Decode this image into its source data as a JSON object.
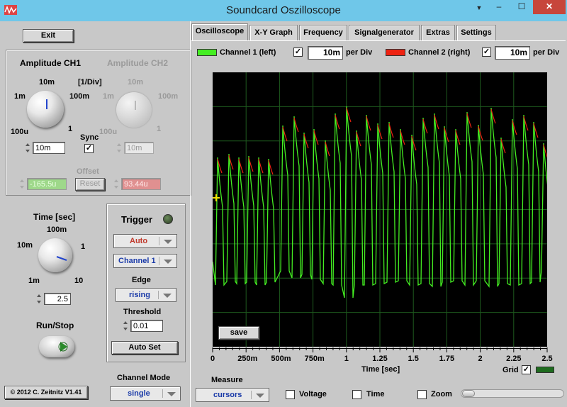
{
  "window": {
    "title": "Soundcard Oszilloscope",
    "close": "✕",
    "minimize": "–",
    "maximize": "☐",
    "menu_arrow": "▼"
  },
  "exit_label": "Exit",
  "amplitude": {
    "ch1_title": "Amplitude CH1",
    "ch2_title": "Amplitude CH2",
    "unit": "[1/Div]",
    "ch1_ticks": [
      "1m",
      "10m",
      "100m",
      "100u",
      "1"
    ],
    "ch2_ticks": [
      "1m",
      "10m",
      "100m",
      "100u",
      "1"
    ],
    "ch1_value": "10m",
    "ch2_value": "10m",
    "sync_label": "Sync",
    "sync_checked": "✓",
    "offset_label": "Offset",
    "offset_ch1": "-165.5u",
    "offset_ch2": "93.44u",
    "reset_label": "Reset"
  },
  "time": {
    "title": "Time [sec]",
    "ticks": [
      "100m",
      "10m",
      "1",
      "1m",
      "10"
    ],
    "value": "2.5"
  },
  "run_stop_label": "Run/Stop",
  "copyright": "© 2012  C. Zeitnitz V1.41",
  "trigger": {
    "title": "Trigger",
    "mode": "Auto",
    "channel": "Channel 1",
    "edge_label": "Edge",
    "edge": "rising",
    "threshold_label": "Threshold",
    "threshold": "0.01",
    "autoset_label": "Auto Set"
  },
  "channel_mode": {
    "label": "Channel Mode",
    "value": "single"
  },
  "tabs": [
    "Oscilloscope",
    "X-Y Graph",
    "Frequency",
    "Signalgenerator",
    "Extras",
    "Settings"
  ],
  "channels": {
    "ch1_label": "Channel 1 (left)",
    "ch1_checked": "✓",
    "ch1_div": "10m",
    "per_div": "per Div",
    "ch2_label": "Channel 2 (right)",
    "ch2_checked": "✓",
    "ch2_div": "10m",
    "ch1_color": "#44ee22",
    "ch2_color": "#ee2211"
  },
  "save_label": "save",
  "x_axis": {
    "ticks": [
      "0",
      "250m",
      "500m",
      "750m",
      "1",
      "1.25",
      "1.5",
      "1.75",
      "2",
      "2.25",
      "2.5"
    ],
    "label": "Time [sec]",
    "grid_label": "Grid",
    "grid_checked": "✓"
  },
  "measure": {
    "label": "Measure",
    "mode": "cursors",
    "voltage_label": "Voltage",
    "time_label": "Time",
    "zoom_label": "Zoom"
  }
}
